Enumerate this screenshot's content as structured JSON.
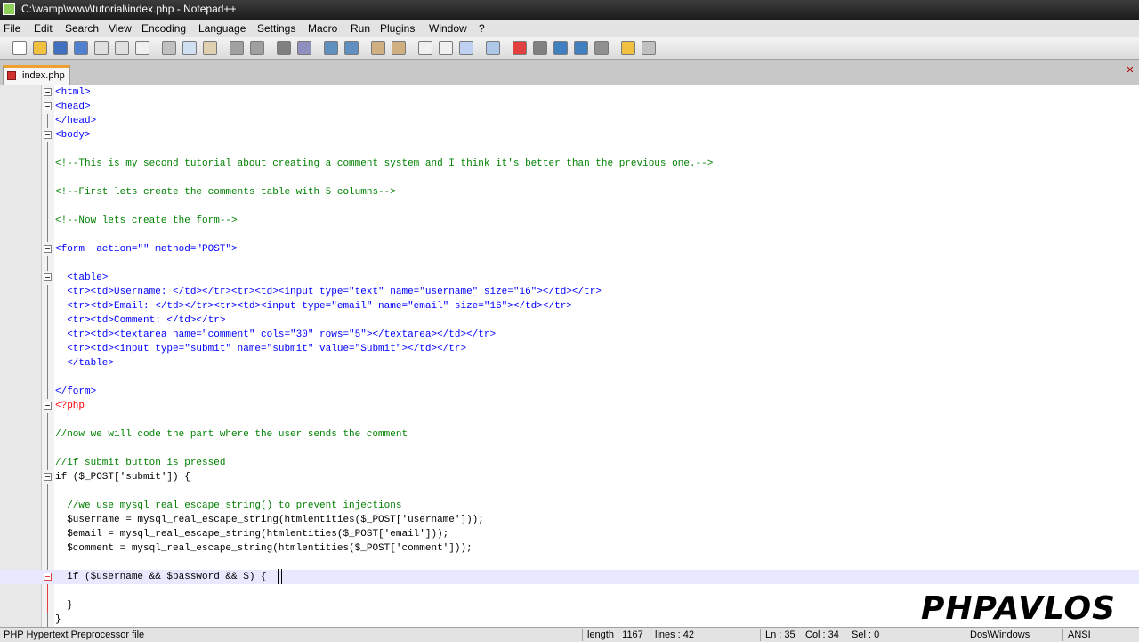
{
  "window": {
    "title": "C:\\wamp\\www\\tutorial\\index.php - Notepad++"
  },
  "menu": {
    "file": "File",
    "edit": "Edit",
    "search": "Search",
    "view": "View",
    "encoding": "Encoding",
    "language": "Language",
    "settings": "Settings",
    "macro": "Macro",
    "run": "Run",
    "plugins": "Plugins",
    "window": "Window",
    "help": "?"
  },
  "tab": {
    "label": "index.php"
  },
  "editor": {
    "lines": [
      "<html>",
      "<head>",
      "</head>",
      "<body>",
      "",
      "<!--This is my second tutorial about creating a comment system and I think it's better than the previous one.-->",
      "",
      "<!--First lets create the comments table with 5 columns-->",
      "",
      "<!--Now lets create the form-->",
      "",
      "<form  action=\"\" method=\"POST\">",
      "",
      "  <table>",
      "  <tr><td>Username: </td></tr><tr><td><input type=\"text\" name=\"username\" size=\"16\"></td></tr>",
      "  <tr><td>Email: </td></tr><tr><td><input type=\"email\" name=\"email\" size=\"16\"></td></tr>",
      "  <tr><td>Comment: </td></tr>",
      "  <tr><td><textarea name=\"comment\" cols=\"30\" rows=\"5\"></textarea></td></tr>",
      "  <tr><td><input type=\"submit\" name=\"submit\" value=\"Submit\"></td></tr>",
      "  </table>",
      "",
      "</form>",
      "<?php",
      "",
      "//now we will code the part where the user sends the comment",
      "",
      "//if submit button is pressed",
      "if ($_POST['submit']) {",
      "",
      "  //we use mysql_real_escape_string() to prevent injections",
      "  $username = mysql_real_escape_string(htmlentities($_POST['username']));",
      "  $email = mysql_real_escape_string(htmlentities($_POST['email']));",
      "  $comment = mysql_real_escape_string(htmlentities($_POST['comment']));",
      "",
      "  if ($username && $password && $) {",
      "    ",
      "  }",
      "}"
    ]
  },
  "watermark": "PHPAVLOS",
  "status": {
    "file_type": "PHP Hypertext Preprocessor file",
    "length": "length : 1167",
    "lines": "lines : 42",
    "ln": "Ln : 35",
    "col": "Col : 34",
    "sel": "Sel : 0",
    "eol": "Dos\\Windows",
    "encoding": "ANSI"
  }
}
